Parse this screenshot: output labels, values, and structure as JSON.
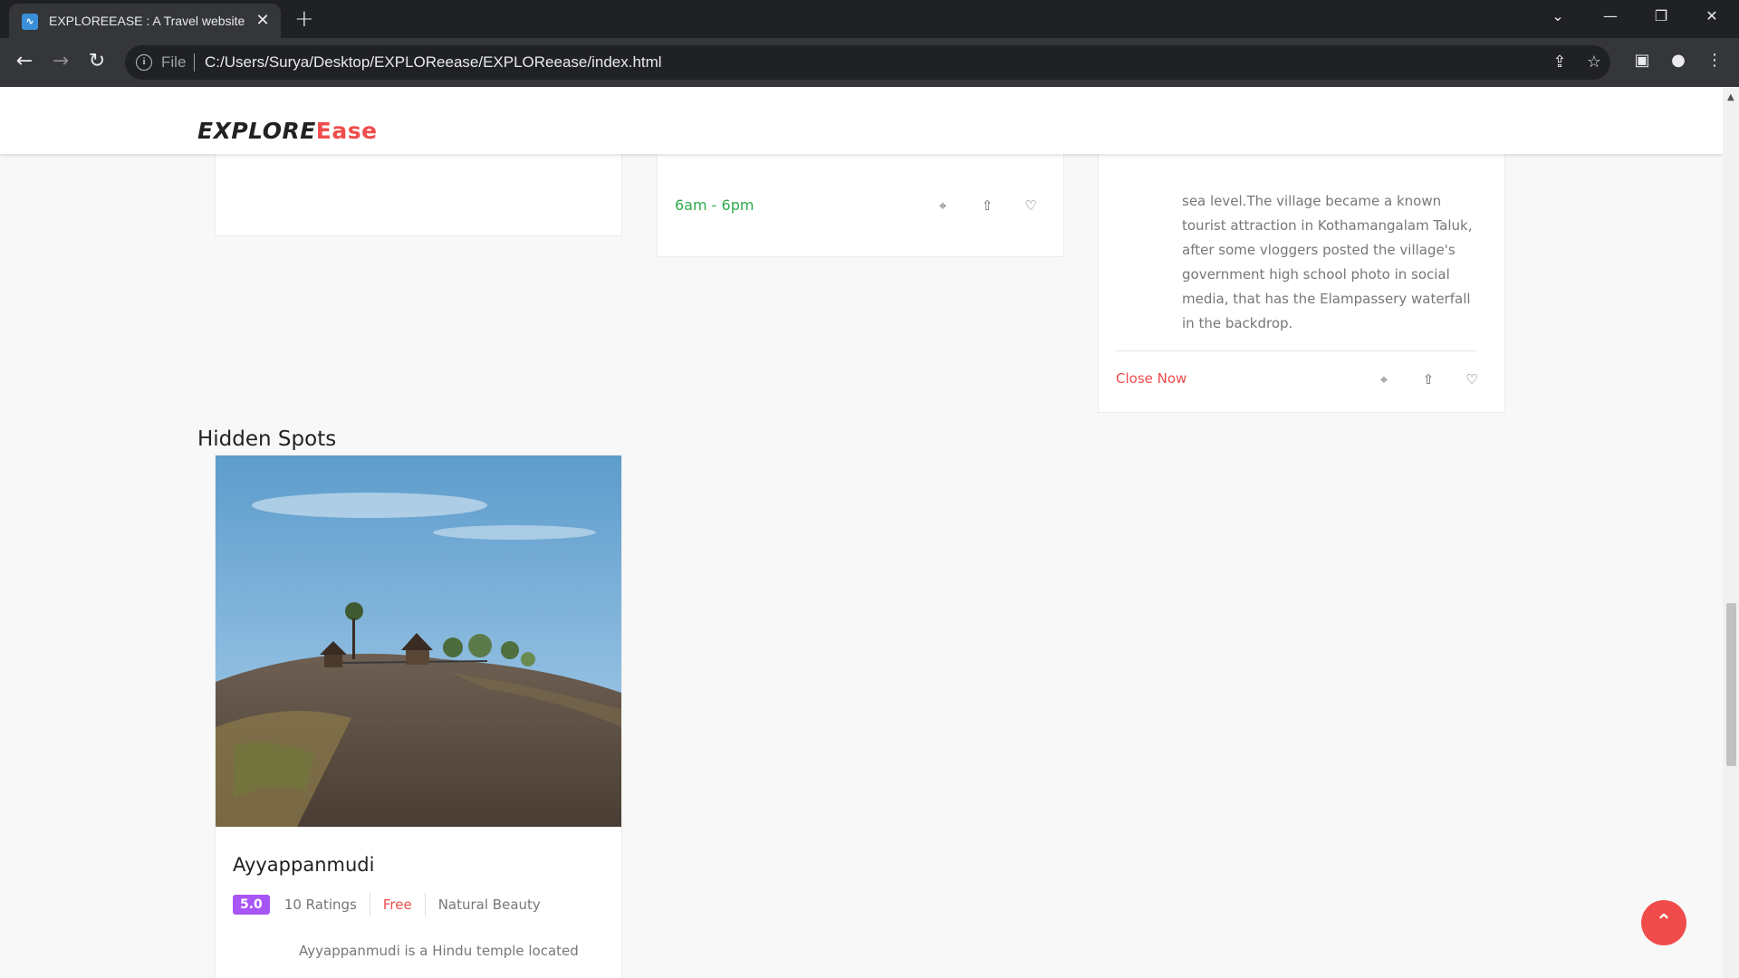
{
  "browser": {
    "tab_title": "EXPLOREEASE : A Travel website",
    "favicon_glyph": "∿",
    "tab_close": "✕",
    "new_tab": "+",
    "omnibox": {
      "scheme_label": "File",
      "url": "C:/Users/Surya/Desktop/EXPLOReease/EXPLOReease/index.html"
    },
    "icons": [
      "back-icon",
      "forward-icon",
      "reload-icon",
      "info-icon",
      "share-icon",
      "bookmark-star-icon",
      "side-panel-icon",
      "profile-icon",
      "menu-icon",
      "tab-search-icon",
      "minimize-icon",
      "restore-icon",
      "close-window-icon"
    ]
  },
  "site": {
    "logo": {
      "main": "EXPLORE",
      "accent": "Ease"
    },
    "accent_color": "#f04c4c",
    "cards_top": {
      "middle": {
        "hours": "6am - 6pm"
      },
      "right": {
        "description": "sea level.The village became a known tourist attraction in Kothamangalam Taluk, after some vloggers posted the village's government high school photo in social media, that has the Elampassery waterfall in the backdrop.",
        "status": "Close Now"
      }
    },
    "section_title": "Hidden Spots",
    "hidden_spot": {
      "name": "Ayyappanmudi",
      "rating": "5.0",
      "ratings_count": "10 Ratings",
      "price": "Free",
      "category": "Natural Beauty",
      "description": "Ayyappanmudi is a Hindu temple located"
    },
    "back_to_top": "⌃"
  }
}
